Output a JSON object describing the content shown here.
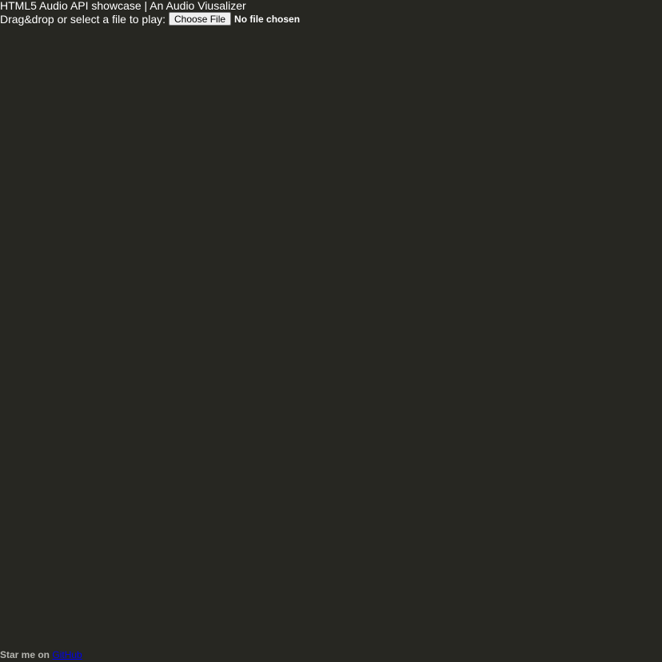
{
  "header": {
    "title": "HTML5 Audio API showcase | An Audio Viusalizer"
  },
  "file_input": {
    "prompt": "Drag&drop or select a file to play:",
    "button_label": "Choose File",
    "status": "No file chosen"
  },
  "footer": {
    "text": "Star me on",
    "link_label": "GitHub"
  },
  "colors": {
    "background": "#272722",
    "text": "#ffffff",
    "link": "#0000ee"
  }
}
